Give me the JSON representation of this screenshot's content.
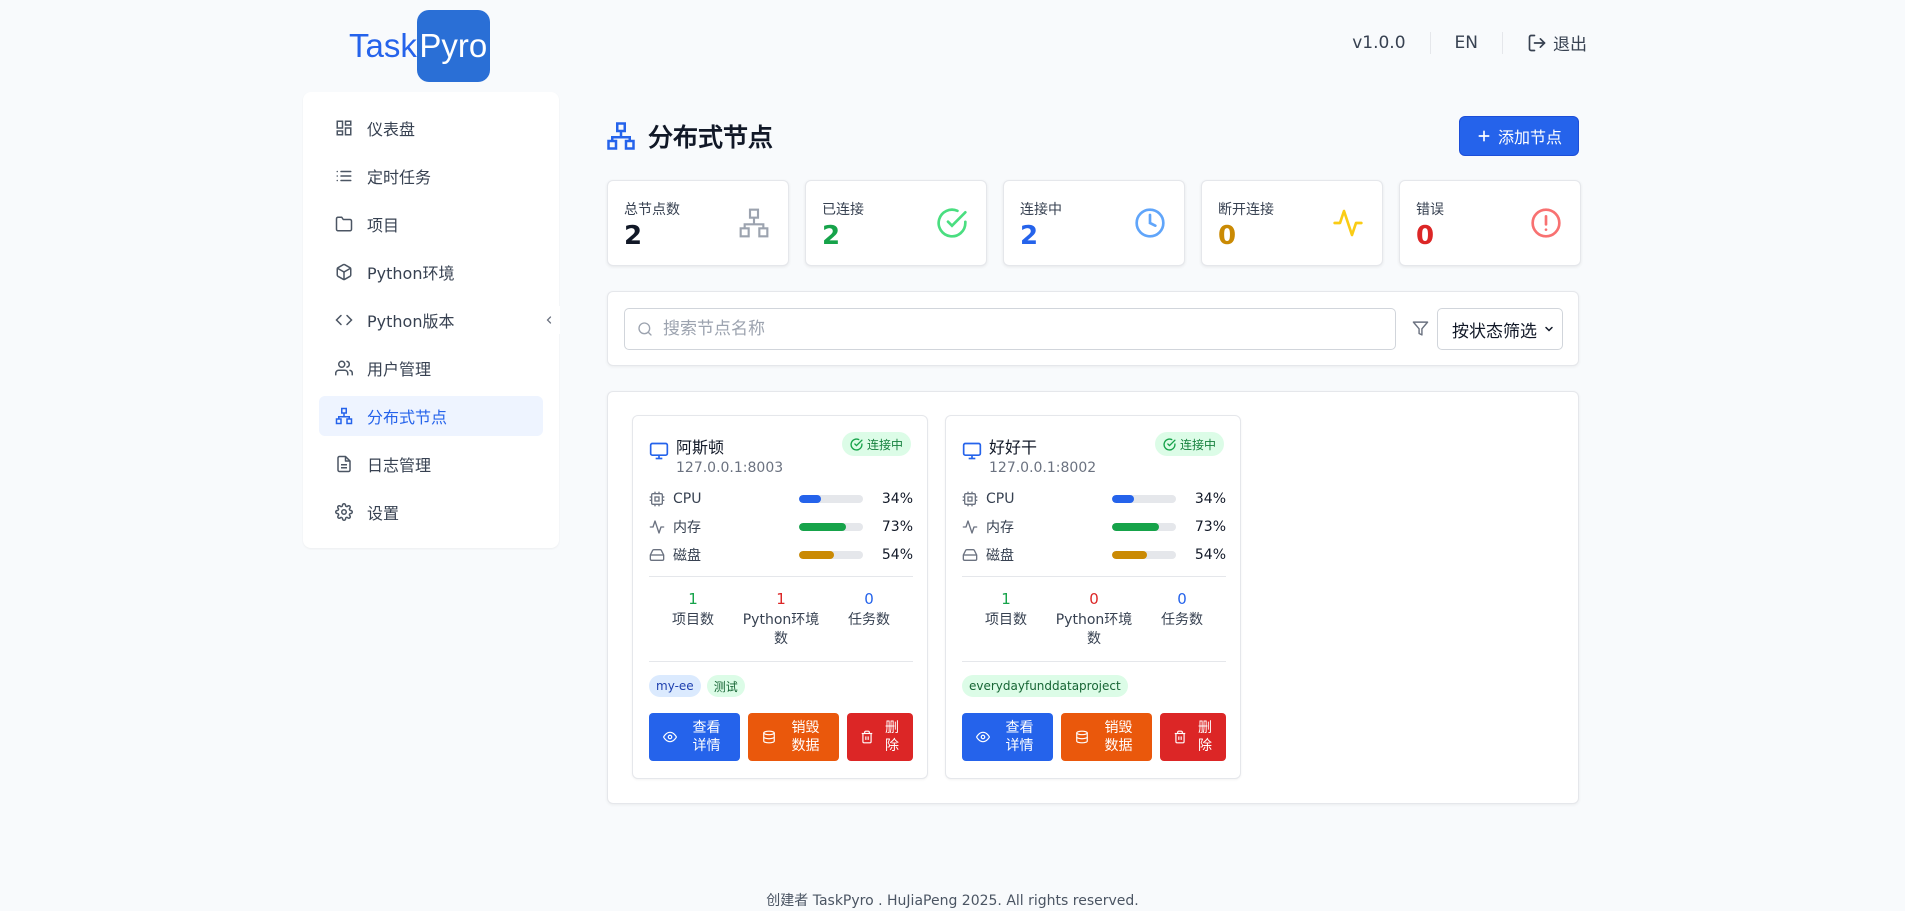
{
  "header": {
    "logo_part1": "Task",
    "logo_part2": "Pyro",
    "version": "v1.0.0",
    "language": "EN",
    "logout_label": "退出"
  },
  "sidebar": {
    "items": [
      {
        "label": "仪表盘",
        "icon": "dashboard-icon"
      },
      {
        "label": "定时任务",
        "icon": "list-icon"
      },
      {
        "label": "项目",
        "icon": "folder-icon"
      },
      {
        "label": "Python环境",
        "icon": "cube-icon"
      },
      {
        "label": "Python版本",
        "icon": "code-icon"
      },
      {
        "label": "用户管理",
        "icon": "users-icon"
      },
      {
        "label": "分布式节点",
        "icon": "network-icon",
        "active": true
      },
      {
        "label": "日志管理",
        "icon": "file-icon"
      },
      {
        "label": "设置",
        "icon": "gear-icon"
      }
    ]
  },
  "page": {
    "title": "分布式节点",
    "add_button": "添加节点"
  },
  "stats": [
    {
      "label": "总节点数",
      "value": "2",
      "color": "#111827",
      "icon": "network-icon",
      "icon_color": "#9ca3af"
    },
    {
      "label": "已连接",
      "value": "2",
      "color": "#16a34a",
      "icon": "check-circle-icon",
      "icon_color": "#4ade80"
    },
    {
      "label": "连接中",
      "value": "2",
      "color": "#2563eb",
      "icon": "clock-icon",
      "icon_color": "#60a5fa"
    },
    {
      "label": "断开连接",
      "value": "0",
      "color": "#ca8a04",
      "icon": "activity-icon",
      "icon_color": "#facc15"
    },
    {
      "label": "错误",
      "value": "0",
      "color": "#dc2626",
      "icon": "alert-circle-icon",
      "icon_color": "#f87171"
    }
  ],
  "filter": {
    "search_placeholder": "搜索节点名称",
    "status_select": "按状态筛选"
  },
  "nodes": [
    {
      "name": "阿斯顿",
      "address": "127.0.0.1:8003",
      "status": "连接中",
      "metrics": [
        {
          "label": "CPU",
          "value": "34%",
          "fraction": 0.34,
          "color": "#2563eb"
        },
        {
          "label": "内存",
          "value": "73%",
          "fraction": 0.73,
          "color": "#16a34a"
        },
        {
          "label": "磁盘",
          "value": "54%",
          "fraction": 0.54,
          "color": "#ca8a04"
        }
      ],
      "counts": [
        {
          "num": "1",
          "label": "项目数",
          "color": "#16a34a"
        },
        {
          "num": "1",
          "label": "Python环境数",
          "color": "#dc2626"
        },
        {
          "num": "0",
          "label": "任务数",
          "color": "#2563eb"
        }
      ],
      "tags": [
        {
          "text": "my-ee",
          "style": "blue"
        },
        {
          "text": "测试",
          "style": "green"
        }
      ],
      "actions": {
        "view": "查看详情",
        "destroy": "销毁数据",
        "delete": "删除"
      }
    },
    {
      "name": "好好干",
      "address": "127.0.0.1:8002",
      "status": "连接中",
      "metrics": [
        {
          "label": "CPU",
          "value": "34%",
          "fraction": 0.34,
          "color": "#2563eb"
        },
        {
          "label": "内存",
          "value": "73%",
          "fraction": 0.73,
          "color": "#16a34a"
        },
        {
          "label": "磁盘",
          "value": "54%",
          "fraction": 0.54,
          "color": "#ca8a04"
        }
      ],
      "counts": [
        {
          "num": "1",
          "label": "项目数",
          "color": "#16a34a"
        },
        {
          "num": "0",
          "label": "Python环境数",
          "color": "#dc2626"
        },
        {
          "num": "0",
          "label": "任务数",
          "color": "#2563eb"
        }
      ],
      "tags": [
        {
          "text": "everydayfunddataproject",
          "style": "green"
        }
      ],
      "actions": {
        "view": "查看详情",
        "destroy": "销毁数据",
        "delete": "删除"
      }
    }
  ],
  "footer": "创建者 TaskPyro . HuJiaPeng 2025. All rights reserved."
}
